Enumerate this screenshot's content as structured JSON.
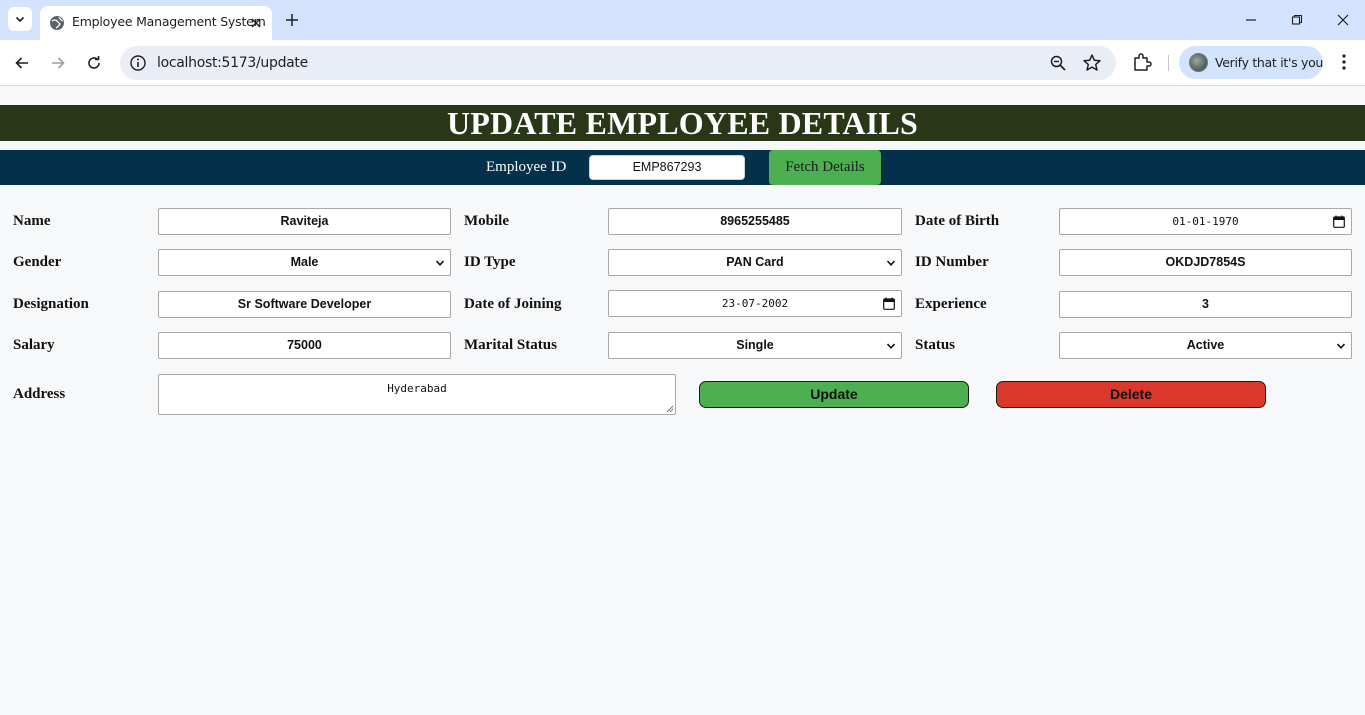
{
  "browser": {
    "tab_title": "Employee Management System",
    "url": "localhost:5173/update",
    "profile_text": "Verify that it's you"
  },
  "page": {
    "title": "UPDATE EMPLOYEE DETAILS",
    "employee_id_label": "Employee ID",
    "employee_id_value": "EMP867293",
    "fetch_button": "Fetch Details"
  },
  "form": {
    "name": {
      "label": "Name",
      "value": "Raviteja"
    },
    "mobile": {
      "label": "Mobile",
      "value": "8965255485"
    },
    "dob": {
      "label": "Date of Birth",
      "value": "01-01-1970"
    },
    "gender": {
      "label": "Gender",
      "value": "Male"
    },
    "id_type": {
      "label": "ID Type",
      "value": "PAN Card"
    },
    "id_number": {
      "label": "ID Number",
      "value": "OKDJD7854S"
    },
    "designation": {
      "label": "Designation",
      "value": "Sr Software Developer"
    },
    "doj": {
      "label": "Date of Joining",
      "value": "23-07-2002"
    },
    "experience": {
      "label": "Experience",
      "value": "3"
    },
    "salary": {
      "label": "Salary",
      "value": "75000"
    },
    "marital_status": {
      "label": "Marital Status",
      "value": "Single"
    },
    "status": {
      "label": "Status",
      "value": "Active"
    },
    "address": {
      "label": "Address",
      "value": "Hyderabad"
    }
  },
  "actions": {
    "update": "Update",
    "delete": "Delete"
  },
  "colors": {
    "banner": "#293618",
    "fetch_bar": "#03304b",
    "update_button": "#4caf50",
    "delete_button": "#d9382a"
  }
}
